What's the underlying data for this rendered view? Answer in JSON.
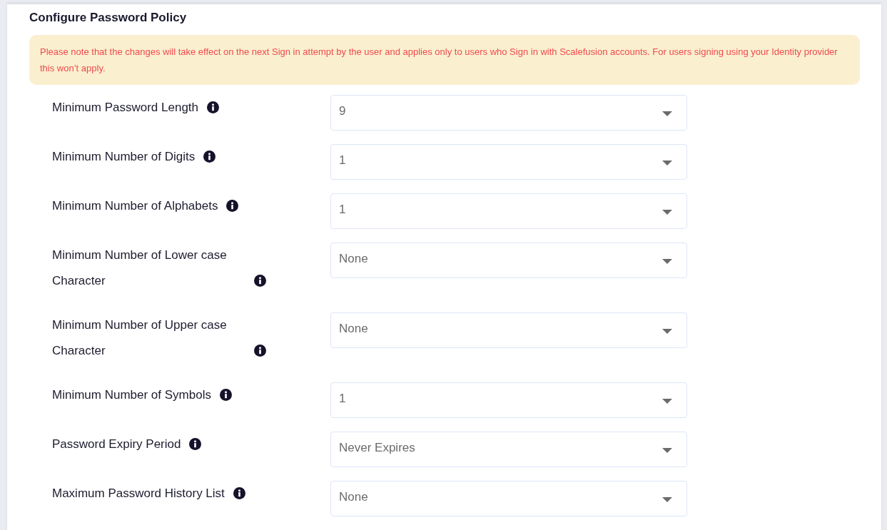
{
  "title": "Configure Password Policy",
  "notice": "Please note that the changes will take effect on the next Sign in attempt by the user and applies only to users who Sign in with Scalefusion accounts. For users signing using your Identity provider this won’t apply.",
  "fields": [
    {
      "label": "Minimum Password Length",
      "value": "9"
    },
    {
      "label": "Minimum Number of Digits",
      "value": "1"
    },
    {
      "label": "Minimum Number of Alphabets",
      "value": "1"
    },
    {
      "label": "Minimum Number of Lower case Character",
      "value": "None"
    },
    {
      "label": "Minimum Number of Upper case Character",
      "value": "None"
    },
    {
      "label": "Minimum Number of Symbols",
      "value": "1"
    },
    {
      "label": "Password Expiry Period",
      "value": "Never Expires"
    },
    {
      "label": "Maximum Password History List",
      "value": "None"
    }
  ]
}
